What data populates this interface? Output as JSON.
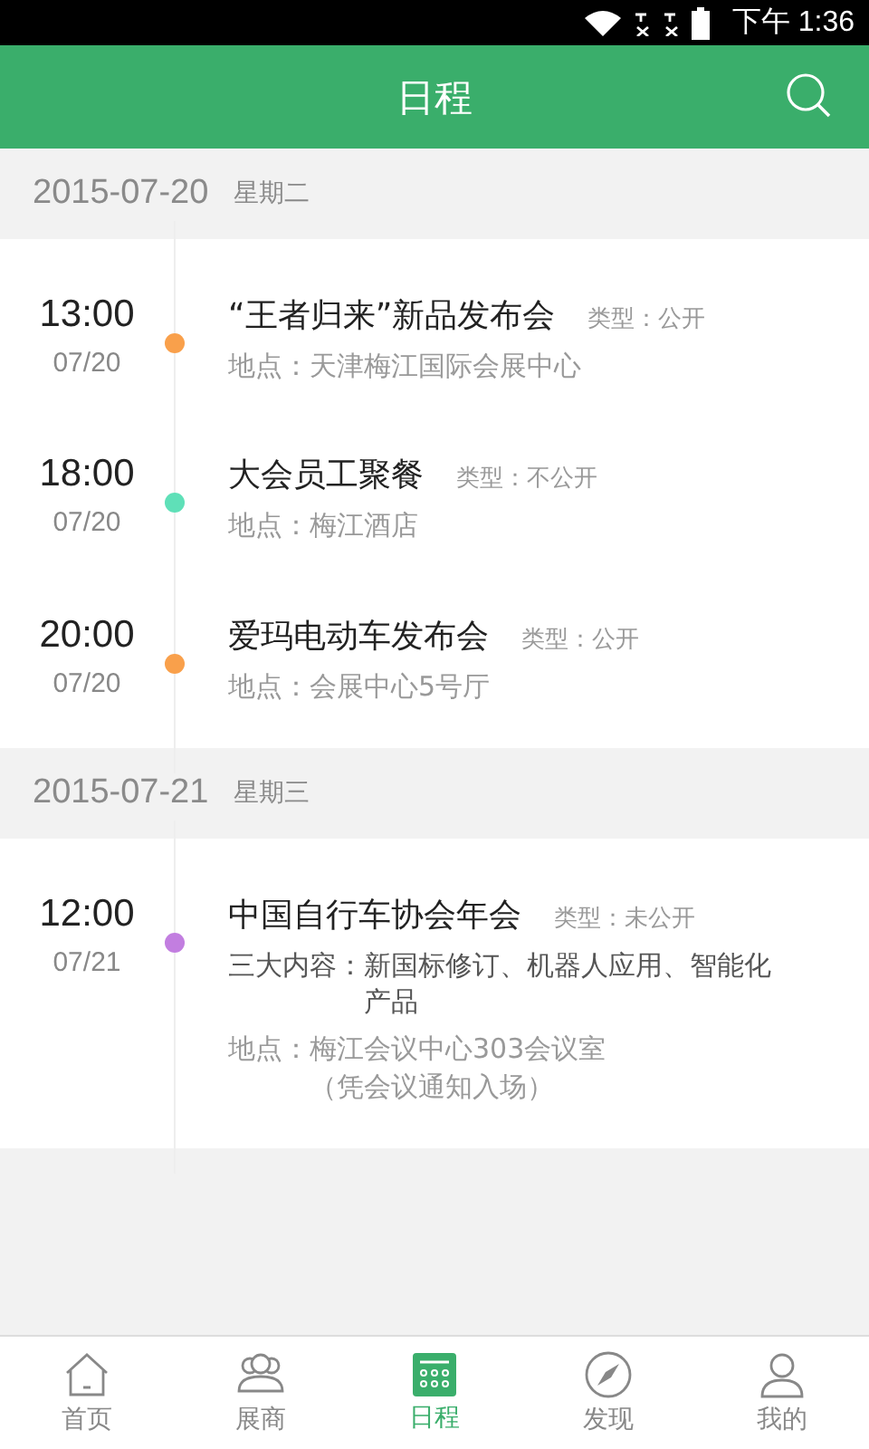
{
  "status_bar": {
    "time": "下午 1:36"
  },
  "header": {
    "title": "日程"
  },
  "days": [
    {
      "date": "2015-07-20",
      "weekday": "星期二",
      "events": [
        {
          "time": "13:00",
          "date": "07/20",
          "title": "“王者归来”新品发布会",
          "type": "类型：公开",
          "color": "#f9a04b",
          "details": [
            {
              "kind": "location",
              "label": "地点：",
              "lines": [
                "天津梅江国际会展中心"
              ]
            }
          ]
        },
        {
          "time": "18:00",
          "date": "07/20",
          "title": "大会员工聚餐",
          "type": "类型：不公开",
          "color": "#5fe0b8",
          "details": [
            {
              "kind": "location",
              "label": "地点：",
              "lines": [
                "梅江酒店"
              ]
            }
          ]
        },
        {
          "time": "20:00",
          "date": "07/20",
          "title": "爱玛电动车发布会",
          "type": "类型：公开",
          "color": "#f9a04b",
          "details": [
            {
              "kind": "location",
              "label": "地点：",
              "lines": [
                "会展中心5号厅"
              ]
            }
          ]
        }
      ]
    },
    {
      "date": "2015-07-21",
      "weekday": "星期三",
      "events": [
        {
          "time": "12:00",
          "date": "07/21",
          "title": "中国自行车协会年会",
          "type": "类型：未公开",
          "color": "#c27ee0",
          "details": [
            {
              "kind": "content",
              "label": "三大内容：",
              "lines": [
                "新国标修订、机器人应用、智能化",
                "产品"
              ]
            },
            {
              "kind": "location",
              "label": "地点：",
              "lines": [
                "梅江会议中心303会议室",
                "（凭会议通知入场）"
              ]
            }
          ]
        }
      ]
    }
  ],
  "tabs": [
    {
      "label": "首页",
      "kind": "home",
      "selected": false
    },
    {
      "label": "展商",
      "kind": "people",
      "selected": false
    },
    {
      "label": "日程",
      "kind": "calendar",
      "selected": true
    },
    {
      "label": "发现",
      "kind": "compass",
      "selected": false
    },
    {
      "label": "我的",
      "kind": "person",
      "selected": false
    }
  ]
}
